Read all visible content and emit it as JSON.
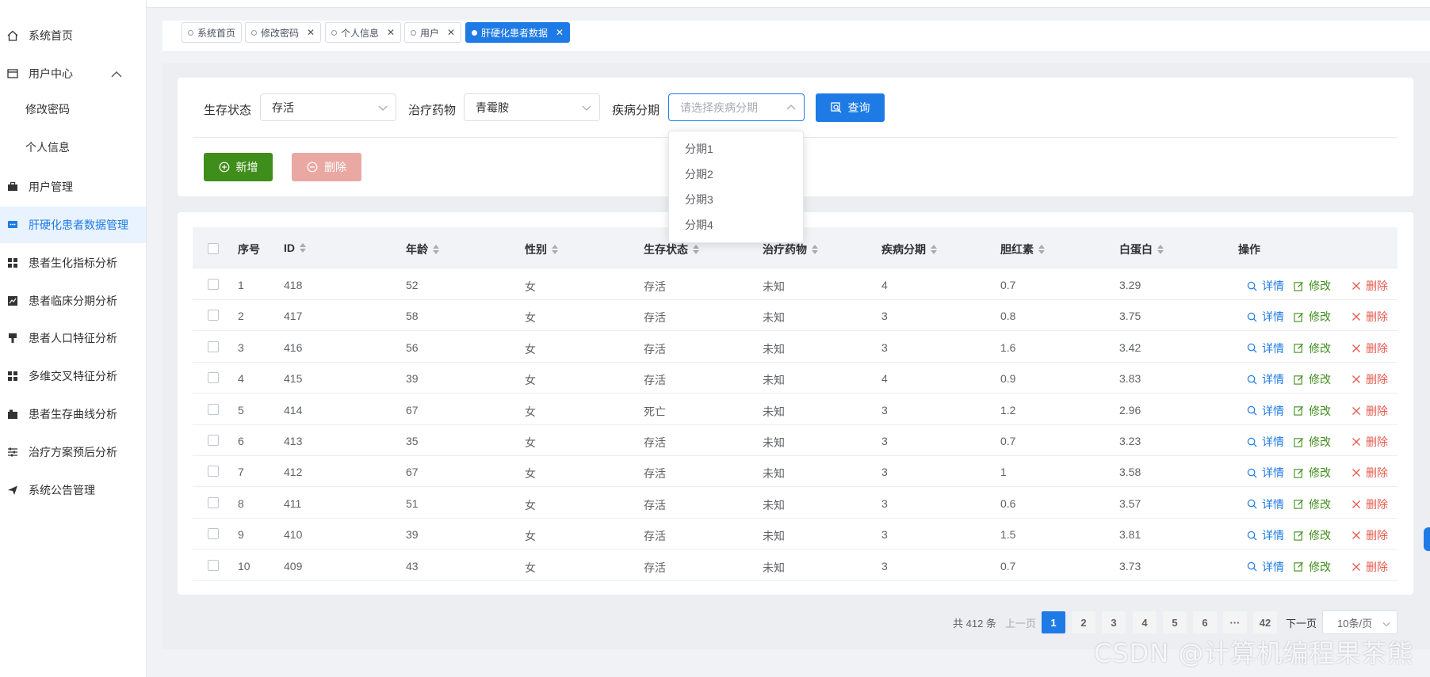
{
  "sidebar": {
    "items": [
      {
        "label": "系统首页",
        "icon": "home-icon"
      },
      {
        "label": "用户中心",
        "icon": "user-center-icon"
      },
      {
        "label": "修改密码"
      },
      {
        "label": "个人信息"
      },
      {
        "label": "用户管理",
        "icon": "briefcase-icon"
      },
      {
        "label": "肝硬化患者数据管理",
        "icon": "chat-icon",
        "active": true
      },
      {
        "label": "患者生化指标分析",
        "icon": "grid-icon"
      },
      {
        "label": "患者临床分期分析",
        "icon": "chart-icon"
      },
      {
        "label": "患者人口特征分析",
        "icon": "stamp-icon"
      },
      {
        "label": "多维交叉特征分析",
        "icon": "grid-icon"
      },
      {
        "label": "患者生存曲线分析",
        "icon": "camera-icon"
      },
      {
        "label": "治疗方案预后分析",
        "icon": "sliders-icon"
      },
      {
        "label": "系统公告管理",
        "icon": "send-icon"
      }
    ]
  },
  "tabs": [
    {
      "label": "系统首页",
      "closable": false
    },
    {
      "label": "修改密码",
      "closable": true
    },
    {
      "label": "个人信息",
      "closable": true
    },
    {
      "label": "用户",
      "closable": true
    },
    {
      "label": "肝硬化患者数据",
      "closable": true,
      "active": true
    }
  ],
  "filters": {
    "status_label": "生存状态",
    "status_value": "存活",
    "drug_label": "治疗药物",
    "drug_value": "青霉胺",
    "stage_label": "疾病分期",
    "stage_placeholder": "请选择疾病分期",
    "query_label": "查询",
    "stage_options": [
      "分期1",
      "分期2",
      "分期3",
      "分期4"
    ]
  },
  "actions": {
    "add_label": "新增",
    "delete_label": "删除"
  },
  "table": {
    "headers": [
      "序号",
      "ID",
      "年龄",
      "性别",
      "生存状态",
      "治疗药物",
      "疾病分期",
      "胆红素",
      "白蛋白",
      "操作"
    ],
    "row_actions": {
      "view": "详情",
      "edit": "修改",
      "remove": "删除"
    },
    "rows": [
      [
        "1",
        "418",
        "52",
        "女",
        "存活",
        "未知",
        "4",
        "0.7",
        "3.29"
      ],
      [
        "2",
        "417",
        "58",
        "女",
        "存活",
        "未知",
        "3",
        "0.8",
        "3.75"
      ],
      [
        "3",
        "416",
        "56",
        "女",
        "存活",
        "未知",
        "3",
        "1.6",
        "3.42"
      ],
      [
        "4",
        "415",
        "39",
        "女",
        "存活",
        "未知",
        "4",
        "0.9",
        "3.83"
      ],
      [
        "5",
        "414",
        "67",
        "女",
        "死亡",
        "未知",
        "3",
        "1.2",
        "2.96"
      ],
      [
        "6",
        "413",
        "35",
        "女",
        "存活",
        "未知",
        "3",
        "0.7",
        "3.23"
      ],
      [
        "7",
        "412",
        "67",
        "女",
        "存活",
        "未知",
        "3",
        "1",
        "3.58"
      ],
      [
        "8",
        "411",
        "51",
        "女",
        "存活",
        "未知",
        "3",
        "0.6",
        "3.57"
      ],
      [
        "9",
        "410",
        "39",
        "女",
        "存活",
        "未知",
        "3",
        "1.5",
        "3.81"
      ],
      [
        "10",
        "409",
        "43",
        "女",
        "存活",
        "未知",
        "3",
        "0.7",
        "3.73"
      ]
    ]
  },
  "pagination": {
    "total": "共 412 条",
    "prev": "上一页",
    "pages": [
      "1",
      "2",
      "3",
      "4",
      "5",
      "6",
      "···",
      "42"
    ],
    "current": "1",
    "next": "下一页",
    "page_size": "10条/页"
  },
  "watermark": "CSDN @计算机编程果茶熊",
  "colors": {
    "primary": "#1e7be6",
    "success": "#3f8d1a",
    "danger": "#e65a4e",
    "danger_light": "#eaa8a3"
  }
}
